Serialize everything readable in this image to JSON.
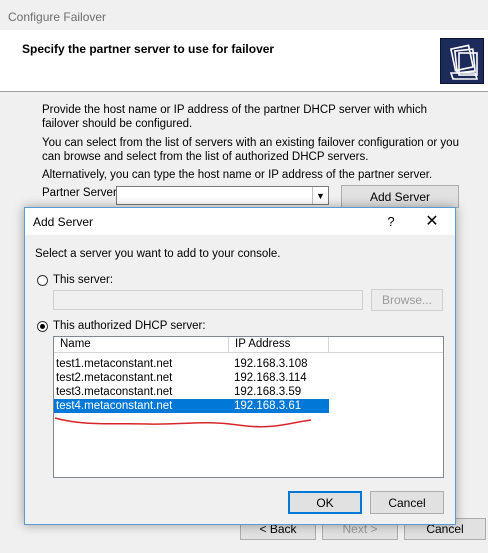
{
  "outer": {
    "window_title": "Configure Failover",
    "heading": "Specify the partner server to use for failover",
    "para1": "Provide the host name or IP address of the partner DHCP server with which failover should be configured.",
    "para2": "You can select from the list of servers with an existing failover configuration or you can browse and select from the list of authorized DHCP servers.",
    "para3": "Alternatively, you can type the host name or IP address of the partner server.",
    "partner_label": "Partner Server:",
    "partner_value": "",
    "add_server_label": "Add Server",
    "back_label": "< Back",
    "next_label": "Next >",
    "cancel_label": "Cancel"
  },
  "dialog": {
    "title": "Add Server",
    "help_label": "?",
    "close_label": "✕",
    "instruction": "Select a server you want to add to your console.",
    "this_server_label": "This server:",
    "this_server_value": "",
    "browse_label": "Browse...",
    "authorized_label": "This authorized DHCP server:",
    "selected_radio": "authorized",
    "columns": [
      "Name",
      "IP Address",
      ""
    ],
    "rows": [
      {
        "name": "test1.metaconstant.net",
        "ip": "192.168.3.108"
      },
      {
        "name": "test2.metaconstant.net",
        "ip": "192.168.3.114"
      },
      {
        "name": "test3.metaconstant.net",
        "ip": "192.168.3.59"
      },
      {
        "name": "test4.metaconstant.net",
        "ip": "192.168.3.61"
      }
    ],
    "selected_row": 3,
    "ok_label": "OK",
    "cancel_label": "Cancel"
  },
  "colors": {
    "selection": "#0078d7",
    "annotation": "#d9262a",
    "wizard_icon_bg": "#1d2a5c"
  }
}
